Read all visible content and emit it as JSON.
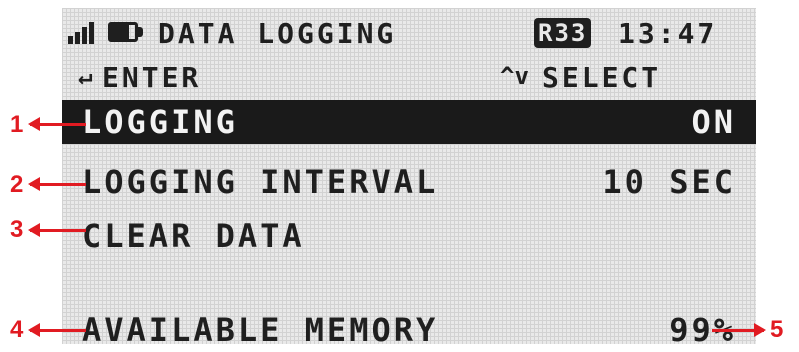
{
  "status": {
    "signal_icon": "signal-bars-icon",
    "battery_icon": "battery-icon",
    "title": "DATA LOGGING",
    "badge": "R33",
    "time": "13:47"
  },
  "hints": {
    "enter_icon": "↵",
    "enter_label": "ENTER",
    "select_icon": "^v",
    "select_label": "SELECT"
  },
  "menu": [
    {
      "label": "LOGGING",
      "value": "ON",
      "selected": true
    },
    {
      "label": "LOGGING INTERVAL",
      "value": "10 SEC"
    },
    {
      "label": "CLEAR DATA",
      "value": ""
    },
    {
      "label": "AVAILABLE MEMORY",
      "value": "99%"
    }
  ],
  "callouts": [
    "1",
    "2",
    "3",
    "4",
    "5"
  ],
  "colors": {
    "lcd_bg": "#e9e9e9",
    "pixel": "#1f1f1f",
    "callout": "#e11b22"
  }
}
